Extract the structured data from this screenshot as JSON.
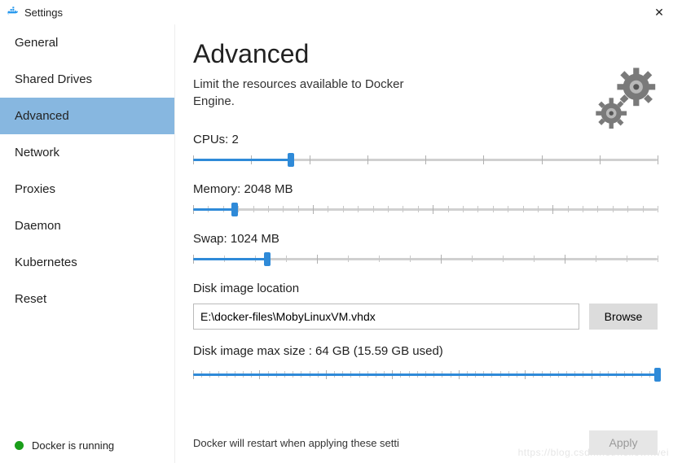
{
  "window": {
    "title": "Settings",
    "close": "✕"
  },
  "sidebar": {
    "items": [
      {
        "label": "General"
      },
      {
        "label": "Shared Drives"
      },
      {
        "label": "Advanced"
      },
      {
        "label": "Network"
      },
      {
        "label": "Proxies"
      },
      {
        "label": "Daemon"
      },
      {
        "label": "Kubernetes"
      },
      {
        "label": "Reset"
      }
    ],
    "status": "Docker is running"
  },
  "page": {
    "title": "Advanced",
    "subtitle": "Limit the resources available to Docker Engine."
  },
  "sliders": {
    "cpus": {
      "label": "CPUs: 2",
      "percent": 21,
      "ticks": 8,
      "big_every": 1
    },
    "memory": {
      "label": "Memory: 2048 MB",
      "percent": 9,
      "ticks": 31,
      "big_every": 8
    },
    "swap": {
      "label": "Swap: 1024 MB",
      "percent": 16,
      "ticks": 15,
      "big_every": 4
    }
  },
  "disk": {
    "location_label": "Disk image location",
    "path": "E:\\docker-files\\MobyLinuxVM.vhdx",
    "browse": "Browse",
    "size_label": "Disk image max size : 64 GB (15.59 GB  used)",
    "size_slider": {
      "percent": 100,
      "ticks": 56,
      "big_every": 8
    }
  },
  "footer": {
    "note": "Docker will restart when applying these setti",
    "apply": "Apply"
  },
  "watermark": "https://blog.csdn.net/hellowhwei"
}
